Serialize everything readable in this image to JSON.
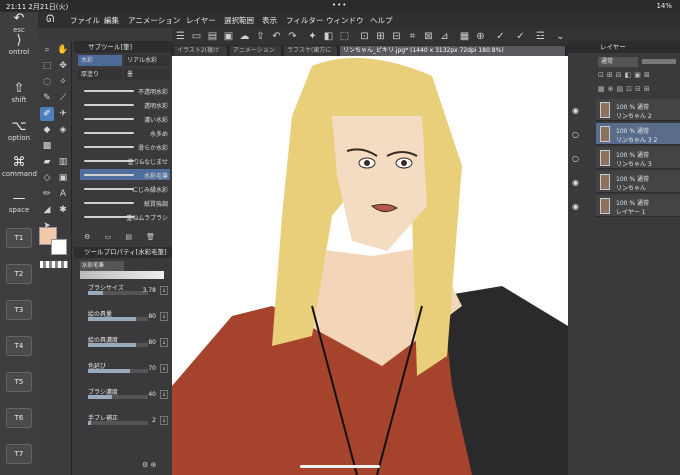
{
  "status": {
    "time": "21:11",
    "date": "2月21日(火)",
    "wifi_battery": "14%",
    "dots": "•••"
  },
  "modifier_keys": [
    {
      "glyph": "",
      "label": "esc"
    },
    {
      "glyph": "⟩",
      "label": "ontrol"
    },
    {
      "glyph": "⇧",
      "label": "shift"
    },
    {
      "glyph": "⌥",
      "label": "option"
    },
    {
      "glyph": "⌘",
      "label": "command"
    },
    {
      "glyph": "—",
      "label": "space"
    }
  ],
  "t_keys": [
    "T1",
    "T2",
    "T3",
    "T4",
    "T5",
    "T6",
    "T7"
  ],
  "menu": [
    "ファイル",
    "編集",
    "アニメーション",
    "レイヤー",
    "選択範囲",
    "表示",
    "フィルター",
    "ウィンドウ",
    "ヘルプ"
  ],
  "tabs": [
    {
      "label": "イラスト2(複け"
    },
    {
      "label": "アニメーション"
    },
    {
      "label": "ラフスケ(東方に"
    },
    {
      "label": "リンちゃん_ピキリ.jpg* (1440 x 3132px 72dpi 180.8%)",
      "active": true
    }
  ],
  "subtool": {
    "title": "サブツール[筆]",
    "groups": [
      "水彩",
      "リアル水彩",
      "厚塗り",
      "墨"
    ],
    "brushes": [
      "不透明水彩",
      "透明水彩",
      "濃い水彩",
      "水多め",
      "滑らか水彩",
      "塗り&なじませ",
      "水彩毛筆",
      "にじみ縁水彩",
      "紙質強調",
      "重ねムラブラシ"
    ],
    "selected_brush": "水彩毛筆"
  },
  "tool_property": {
    "title": "ツールプロパティ[水彩毛筆]",
    "tool_name": "水彩毛筆",
    "rows": [
      {
        "label": "ブラシサイズ",
        "value": "3.78",
        "level": 0.25
      },
      {
        "label": "絵の具量",
        "value": "80",
        "level": 0.8
      },
      {
        "label": "絵の具濃度",
        "value": "80",
        "level": 0.8
      },
      {
        "label": "色延び",
        "value": "70",
        "level": 0.7
      },
      {
        "label": "ブラシ濃度",
        "value": "40",
        "level": 0.4
      },
      {
        "label": "手ブレ補正",
        "value": "2",
        "level": 0.05
      }
    ]
  },
  "layers": {
    "title": "レイヤー",
    "blend_mode": "通常",
    "items": [
      {
        "opacity": "100 %",
        "mode": "通常",
        "name": "リンちゃん 2",
        "visible": true,
        "active": false
      },
      {
        "opacity": "100 %",
        "mode": "通常",
        "name": "リンちゃん 3 2",
        "visible": false,
        "active": true
      },
      {
        "opacity": "100 %",
        "mode": "通常",
        "name": "リンちゃん 3",
        "visible": false,
        "active": false
      },
      {
        "opacity": "100 %",
        "mode": "通常",
        "name": "リンちゃん",
        "visible": true,
        "active": false
      },
      {
        "opacity": "100 %",
        "mode": "通常",
        "name": "レイヤー 1",
        "visible": true,
        "active": false
      }
    ]
  },
  "colors": {
    "main": "#f2c9a8",
    "sub": "#ffffff",
    "accent": "#4f7fbf"
  }
}
